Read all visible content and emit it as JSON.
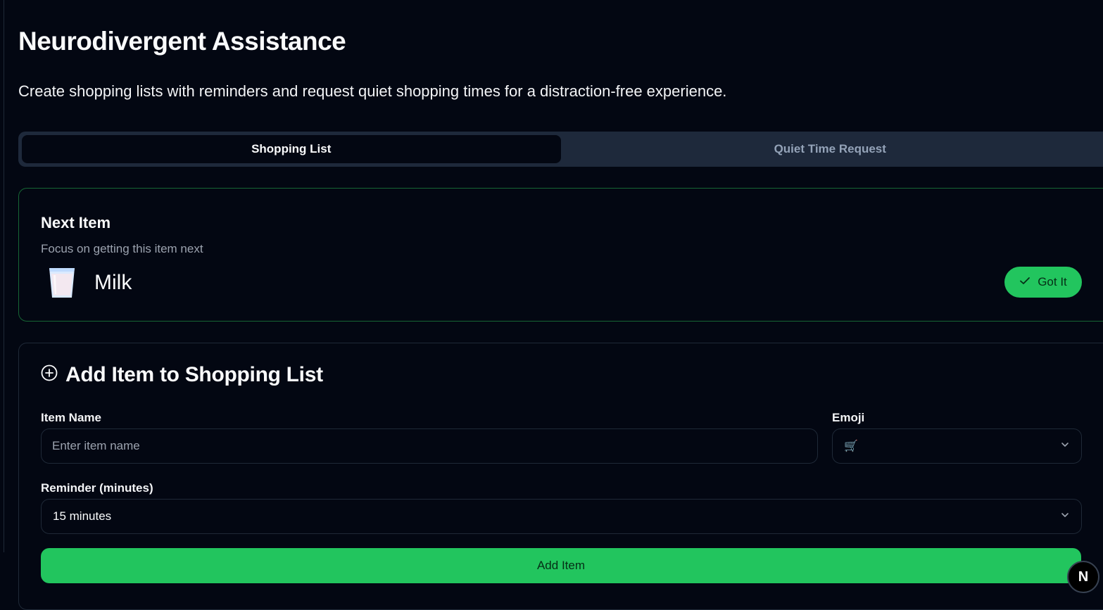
{
  "header": {
    "title": "Neurodivergent Assistance",
    "subtitle": "Create shopping lists with reminders and request quiet shopping times for a distraction-free experience."
  },
  "tabs": [
    {
      "label": "Shopping List",
      "active": true
    },
    {
      "label": "Quiet Time Request",
      "active": false
    }
  ],
  "next_item": {
    "title": "Next Item",
    "description": "Focus on getting this item next",
    "icon": "milk-glass-icon",
    "name": "Milk",
    "button_label": "Got It"
  },
  "add_item": {
    "title": "Add Item to Shopping List",
    "item_name_label": "Item Name",
    "item_name_placeholder": "Enter item name",
    "emoji_label": "Emoji",
    "emoji_value": "🛒",
    "reminder_label": "Reminder (minutes)",
    "reminder_value": "15 minutes",
    "button_label": "Add Item"
  },
  "badge": {
    "label": "N"
  },
  "colors": {
    "background": "#030712",
    "accent": "#22c55e",
    "tab_bar": "#1e293b",
    "border": "#1f2937",
    "highlight_border": "#166534"
  }
}
